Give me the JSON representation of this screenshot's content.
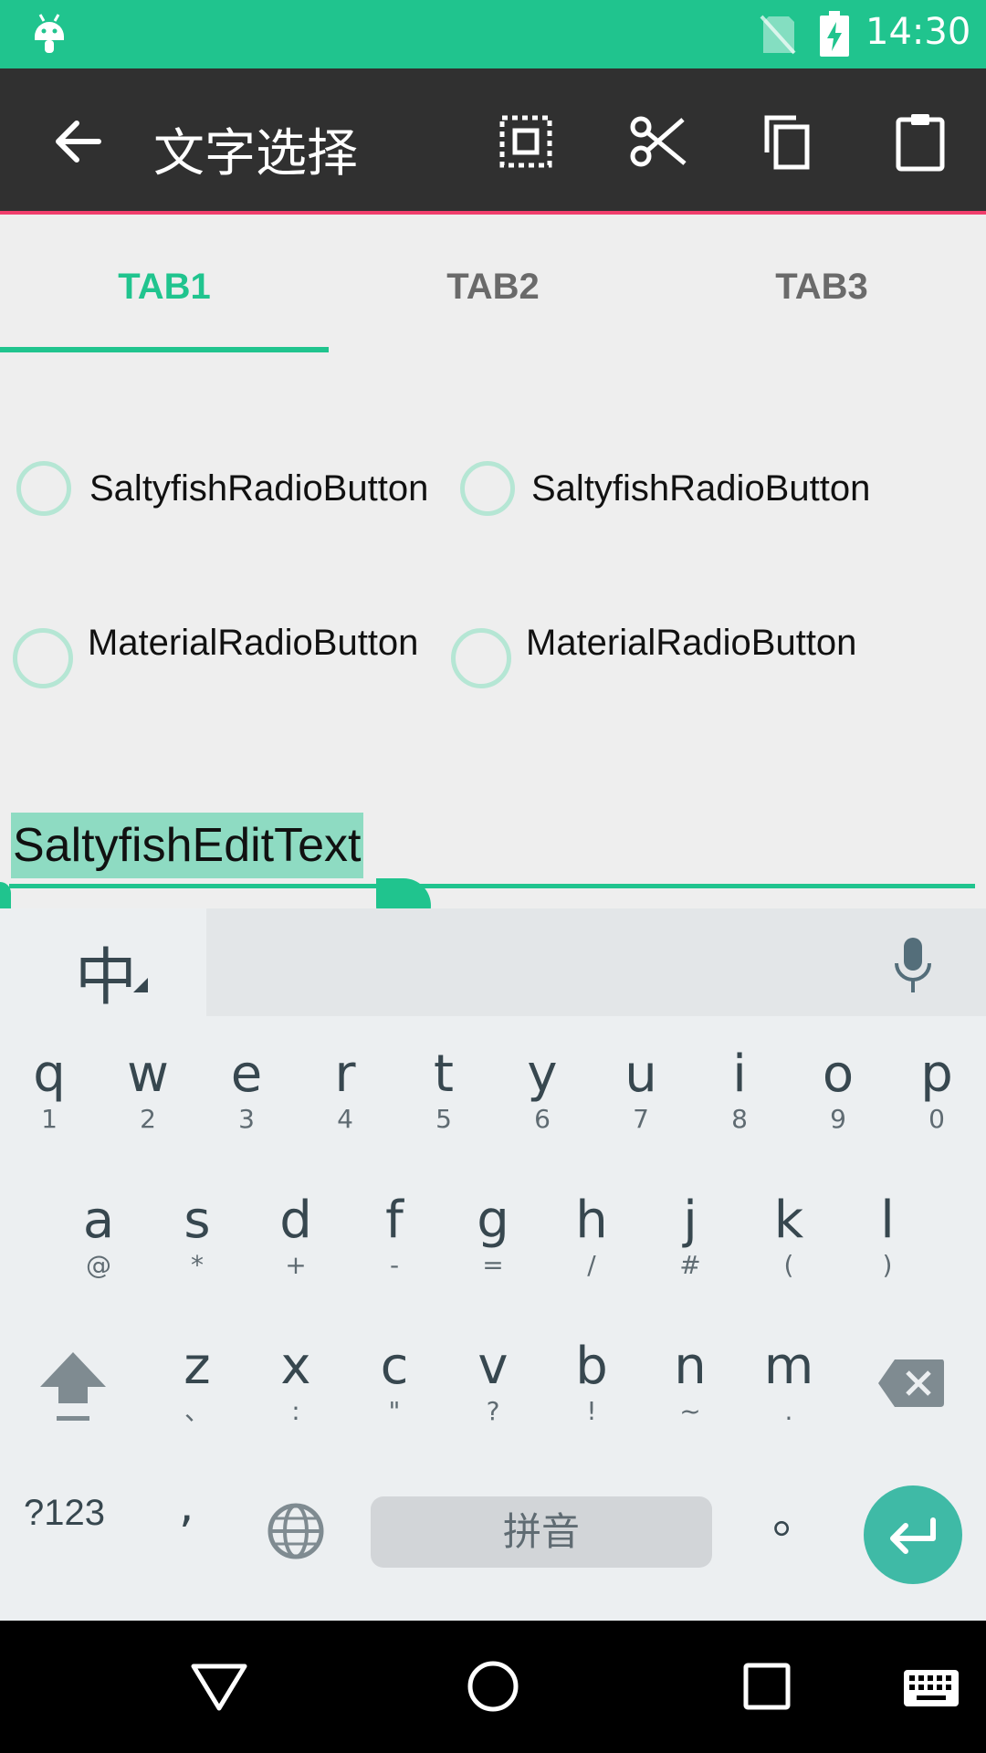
{
  "status_bar": {
    "time": "14:30",
    "background": "#20c48e"
  },
  "action_bar": {
    "title": "文字选择",
    "accent_color": "#f03e6c",
    "icons": [
      "back-arrow-icon",
      "select-all-icon",
      "cut-icon",
      "copy-icon",
      "paste-icon"
    ]
  },
  "tabs": [
    {
      "label": "TAB1",
      "active": true
    },
    {
      "label": "TAB2",
      "active": false
    },
    {
      "label": "TAB3",
      "active": false
    }
  ],
  "radios": {
    "saltyfish_1": "SaltyfishRadioButton",
    "saltyfish_2": "SaltyfishRadioButton",
    "material_1": "MaterialRadioButton",
    "material_2": "MaterialRadioButton"
  },
  "edit_text": {
    "value": "SaltyfishEditText",
    "selected": true
  },
  "keyboard": {
    "lang_key": "中",
    "row1": [
      {
        "k": "q",
        "s": "1"
      },
      {
        "k": "w",
        "s": "2"
      },
      {
        "k": "e",
        "s": "3"
      },
      {
        "k": "r",
        "s": "4"
      },
      {
        "k": "t",
        "s": "5"
      },
      {
        "k": "y",
        "s": "6"
      },
      {
        "k": "u",
        "s": "7"
      },
      {
        "k": "i",
        "s": "8"
      },
      {
        "k": "o",
        "s": "9"
      },
      {
        "k": "p",
        "s": "0"
      }
    ],
    "row2": [
      {
        "k": "a",
        "s": "@"
      },
      {
        "k": "s",
        "s": "*"
      },
      {
        "k": "d",
        "s": "+"
      },
      {
        "k": "f",
        "s": "-"
      },
      {
        "k": "g",
        "s": "="
      },
      {
        "k": "h",
        "s": "/"
      },
      {
        "k": "j",
        "s": "#"
      },
      {
        "k": "k",
        "s": "("
      },
      {
        "k": "l",
        "s": ")"
      }
    ],
    "row3": [
      {
        "k": "z",
        "s": "、"
      },
      {
        "k": "x",
        "s": ":"
      },
      {
        "k": "c",
        "s": "\""
      },
      {
        "k": "v",
        "s": "?"
      },
      {
        "k": "b",
        "s": "!"
      },
      {
        "k": "n",
        "s": "~"
      },
      {
        "k": "m",
        "s": "."
      }
    ],
    "symbols_key": "?123",
    "comma_key": ",",
    "space_key": "拼音",
    "period_key": "。",
    "enter_color": "#3fbaa6"
  }
}
